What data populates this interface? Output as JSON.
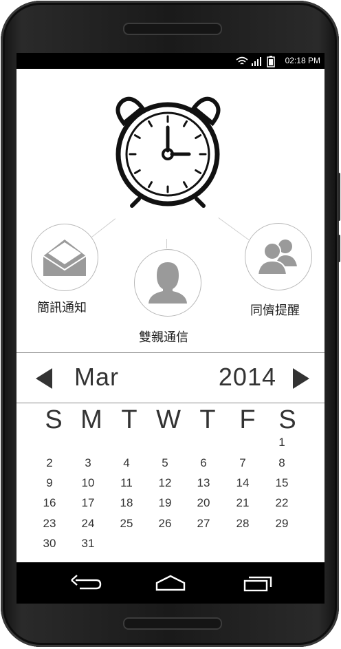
{
  "status_bar": {
    "time": "02:18 PM",
    "icons": [
      "wifi-icon",
      "signal-icon",
      "battery-icon"
    ]
  },
  "hero": {
    "icon": "alarm-clock-icon"
  },
  "contacts": [
    {
      "label": "簡訊通知",
      "icon": "envelope-icon"
    },
    {
      "label": "雙親通信",
      "icon": "person-icon"
    },
    {
      "label": "同儕提醒",
      "icon": "group-icon"
    }
  ],
  "calendar": {
    "month": "Mar",
    "year": "2014",
    "weekdays": [
      "S",
      "M",
      "T",
      "W",
      "T",
      "F",
      "S"
    ],
    "weeks": [
      [
        "",
        "",
        "",
        "",
        "",
        "",
        "1"
      ],
      [
        "2",
        "3",
        "4",
        "5",
        "6",
        "7",
        "8"
      ],
      [
        "9",
        "10",
        "11",
        "12",
        "13",
        "14",
        "15"
      ],
      [
        "16",
        "17",
        "18",
        "19",
        "20",
        "21",
        "22"
      ],
      [
        "23",
        "24",
        "25",
        "26",
        "27",
        "28",
        "29"
      ],
      [
        "30",
        "31",
        "",
        "",
        "",
        "",
        ""
      ]
    ]
  },
  "navbar": {
    "buttons": [
      "back-icon",
      "home-icon",
      "recent-apps-icon"
    ]
  },
  "colors": {
    "icon_gray": "#9a9a9a",
    "text_dark": "#333333",
    "frame": "#1a1a1a"
  }
}
